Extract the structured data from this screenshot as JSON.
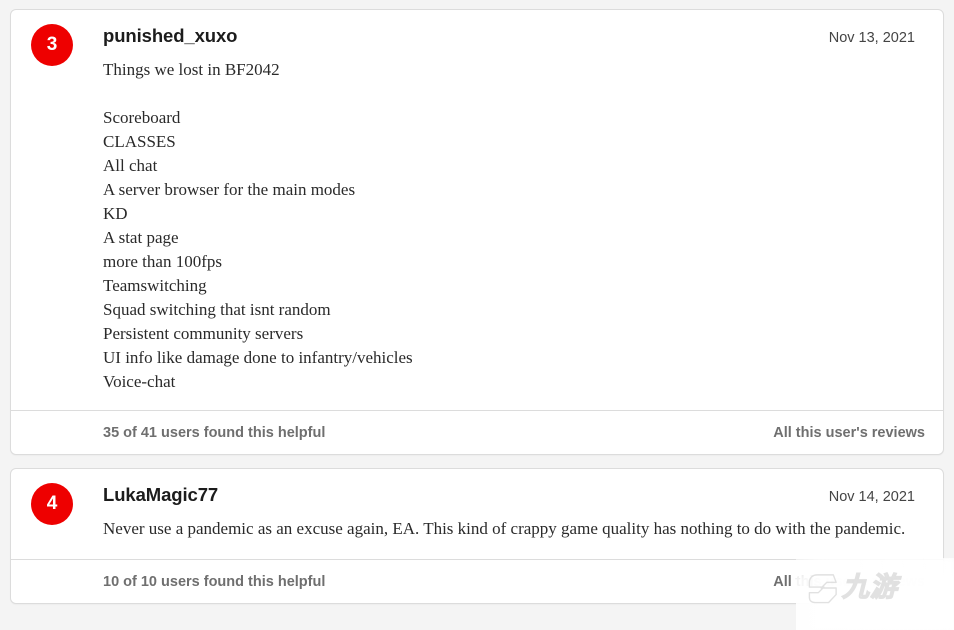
{
  "page": {
    "background_color": "#f4f4f4",
    "card_background": "#ffffff",
    "badge_color": "#ee0000",
    "border_color": "#dcdcdc"
  },
  "reviews": [
    {
      "rank": "3",
      "username": "punished_xuxo",
      "date": "Nov 13, 2021",
      "text": "Things we lost in BF2042\n\nScoreboard\nCLASSES\nAll chat\nA server browser for the main modes\nKD\nA stat page\nmore than 100fps\nTeamswitching\nSquad switching that isnt random\nPersistent community servers\nUI info like damage done to infantry/vehicles\nVoice-chat",
      "helpful": "35 of 41 users found this helpful",
      "user_reviews_link": "All this user's reviews"
    },
    {
      "rank": "4",
      "username": "LukaMagic77",
      "date": "Nov 14, 2021",
      "text": "Never use a pandemic as an excuse again, EA. This kind of crappy game quality has nothing to do with the pandemic.",
      "helpful": "10 of 10 users found this helpful",
      "user_reviews_link": "All this user's reviews"
    }
  ],
  "watermark": {
    "text": "九游",
    "logo": "jiuyou-logo-icon"
  }
}
